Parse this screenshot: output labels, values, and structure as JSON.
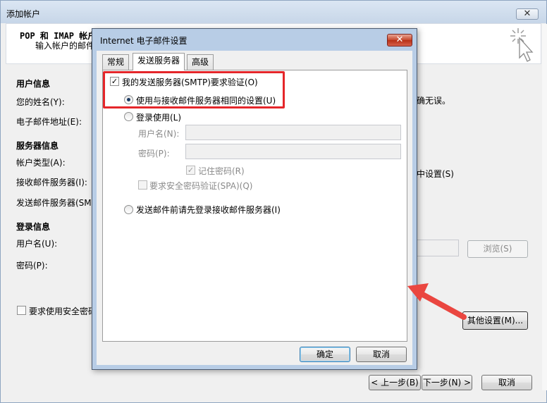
{
  "outer": {
    "title": "添加帐户",
    "close_label": "✕",
    "header_title": "POP 和 IMAP 帐户",
    "header_sub": "输入帐户的邮件",
    "user_info": "用户信息",
    "your_name": "您的姓名(Y):",
    "email": "电子邮件地址(E):",
    "server_info": "服务器信息",
    "account_type": "帐户类型(A):",
    "incoming": "接收邮件服务器(I):",
    "outgoing": "发送邮件服务器(SM",
    "login_info": "登录信息",
    "username": "用户名(U):",
    "password": "密码(P):",
    "spa_partial": "要求使用安全密码",
    "right_text_1": "确无误。",
    "right_text_2": "中设置(S)",
    "browse": "浏览(S)",
    "more_settings": "其他设置(M)...",
    "back": "< 上一步(B)",
    "next": "下一步(N) >",
    "cancel": "取消"
  },
  "dialog": {
    "title": "Internet 电子邮件设置",
    "close_label": "✕",
    "tabs": [
      "常规",
      "发送服务器",
      "高级"
    ],
    "smtp_auth": "我的发送服务器(SMTP)要求验证(O)",
    "same_settings": "使用与接收邮件服务器相同的设置(U)",
    "login_with": "登录使用(L)",
    "username": "用户名(N):",
    "password": "密码(P):",
    "remember_password": "记住密码(R)",
    "require_spa": "要求安全密码验证(SPA)(Q)",
    "login_before_send": "发送邮件前请先登录接收邮件服务器(I)",
    "ok": "确定",
    "cancel": "取消"
  },
  "colors": {
    "highlight": "#e5262a",
    "arrow": "#ea4640"
  }
}
